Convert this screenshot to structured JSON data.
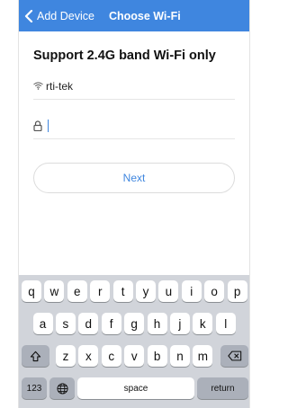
{
  "nav": {
    "back_label": "Add Device",
    "title": "Choose Wi-Fi"
  },
  "heading": "Support 2.4G band Wi-Fi only",
  "wifi": {
    "ssid": "rti-tek",
    "icon": "wifi-icon"
  },
  "password": {
    "value": "",
    "icon": "lock-icon"
  },
  "next_button": "Next",
  "keyboard": {
    "row1": [
      "q",
      "w",
      "e",
      "r",
      "t",
      "y",
      "u",
      "i",
      "o",
      "p"
    ],
    "row2": [
      "a",
      "s",
      "d",
      "f",
      "g",
      "h",
      "j",
      "k",
      "l"
    ],
    "row3": [
      "z",
      "x",
      "c",
      "v",
      "b",
      "n",
      "m"
    ],
    "numbers_key": "123",
    "space_key": "space",
    "return_key": "return",
    "shift_icon": "shift-icon",
    "delete_icon": "delete-icon",
    "globe_icon": "globe-icon"
  },
  "colors": {
    "accent": "#3f86df",
    "keyboard_bg": "#d1d4da",
    "dark_key": "#abb0ba"
  }
}
